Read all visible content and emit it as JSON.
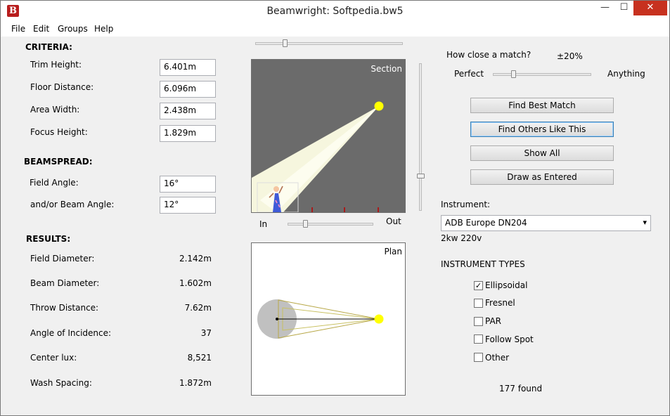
{
  "window": {
    "title": "Beamwright: Softpedia.bw5",
    "app_icon_letter": "B",
    "min_glyph": "—",
    "max_glyph": "☐",
    "close_glyph": "✕"
  },
  "menu": [
    "File",
    "Edit",
    "Groups",
    "Help"
  ],
  "criteria": {
    "heading": "CRITERIA:",
    "trim_height_label": "Trim Height:",
    "trim_height_value": "6.401m",
    "floor_distance_label": "Floor Distance:",
    "floor_distance_value": "6.096m",
    "area_width_label": "Area Width:",
    "area_width_value": "2.438m",
    "focus_height_label": "Focus Height:",
    "focus_height_value": "1.829m"
  },
  "beamspread": {
    "heading": "BEAMSPREAD:",
    "field_angle_label": "Field Angle:",
    "field_angle_value": "16°",
    "beam_angle_label": "and/or Beam Angle:",
    "beam_angle_value": "12°"
  },
  "results": {
    "heading": "RESULTS:",
    "rows": [
      {
        "label": "Field Diameter:",
        "value": "2.142m"
      },
      {
        "label": "Beam Diameter:",
        "value": "1.602m"
      },
      {
        "label": "Throw Distance:",
        "value": "7.62m"
      },
      {
        "label": "Angle of Incidence:",
        "value": "37"
      },
      {
        "label": "Center lux:",
        "value": "8,521"
      },
      {
        "label": "Wash Spacing:",
        "value": "1.872m"
      }
    ]
  },
  "section_view": {
    "title": "Section",
    "in_label": "In",
    "out_label": "Out",
    "colors": {
      "background": "#6b6b6b",
      "beam": "#f6f6de",
      "source": "#ffff00",
      "marker": "#c00000"
    }
  },
  "plan_view": {
    "title": "Plan",
    "colors": {
      "background": "#ffffff",
      "field": "#c0c0c0",
      "source": "#ffff00"
    }
  },
  "match": {
    "question": "How close a match?",
    "tolerance": "±20%",
    "perfect_label": "Perfect",
    "anything_label": "Anything"
  },
  "buttons": {
    "find_best_match": "Find Best Match",
    "find_others": "Find Others Like This",
    "show_all": "Show All",
    "draw_as_entered": "Draw as Entered"
  },
  "instrument": {
    "label": "Instrument:",
    "selected": "ADB Europe DN204",
    "spec": "2kw 220v"
  },
  "instrument_types": {
    "heading": "INSTRUMENT TYPES",
    "items": [
      {
        "label": "Ellipsoidal",
        "checked": true
      },
      {
        "label": "Fresnel",
        "checked": false
      },
      {
        "label": "PAR",
        "checked": false
      },
      {
        "label": "Follow Spot",
        "checked": false
      },
      {
        "label": "Other",
        "checked": false
      }
    ]
  },
  "found_count": "177 found"
}
